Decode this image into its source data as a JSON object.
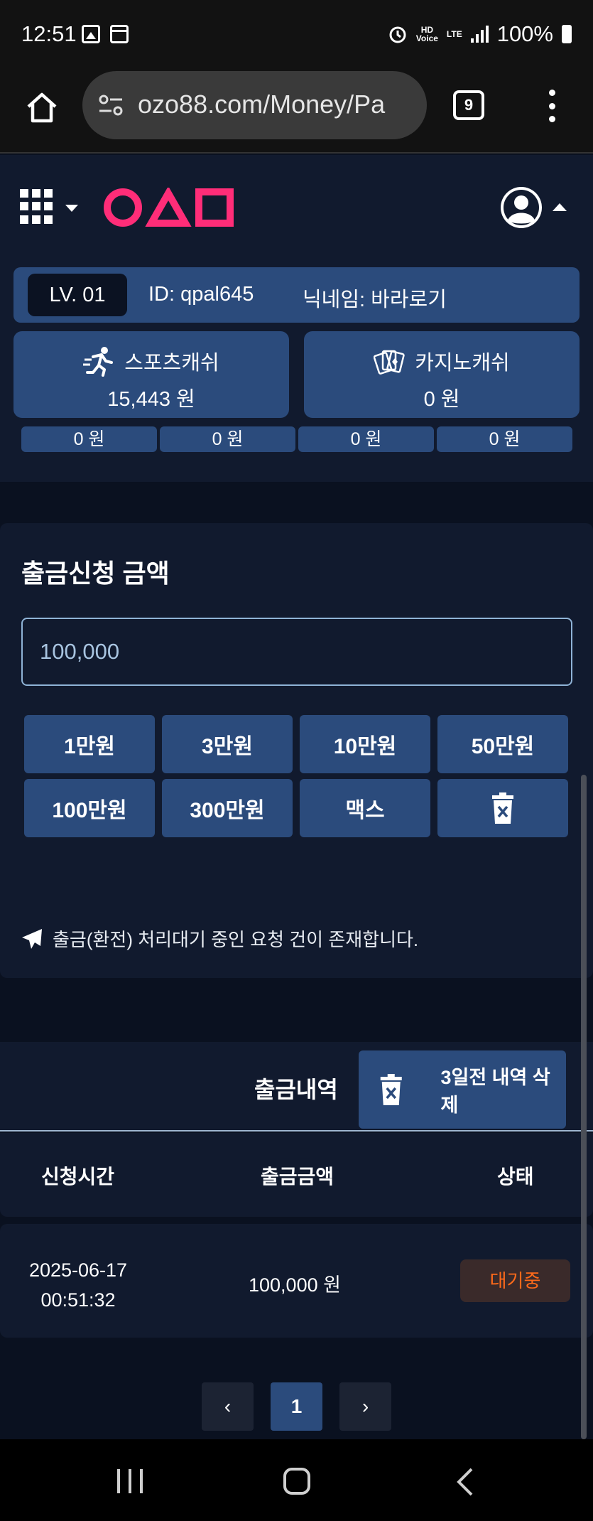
{
  "status_bar": {
    "time": "12:51",
    "hd_label": "HD",
    "voice_label": "Voice",
    "lte_label": "LTE",
    "battery": "100%"
  },
  "browser": {
    "url": "ozo88.com/Money/Pa",
    "tab_count": "9"
  },
  "header": {
    "level": "LV. 01",
    "user_id": "ID: qpal645",
    "nickname": "닉네임: 바라로기",
    "sports_cash": {
      "label": "스포츠캐쉬",
      "value": "15,443 원"
    },
    "casino_cash": {
      "label": "카지노캐쉬",
      "value": "0 원"
    },
    "mini_values": [
      "0 원",
      "0 원",
      "0 원",
      "0 원"
    ]
  },
  "withdraw": {
    "title": "출금신청 금액",
    "amount_value": "100,000",
    "buttons": [
      "1만원",
      "3만원",
      "10만원",
      "50만원",
      "100만원",
      "300만원",
      "맥스"
    ],
    "notice": "출금(환전) 처리대기 중인 요청 건이 존재합니다."
  },
  "history": {
    "title": "출금내역",
    "delete_label": "3일전 내역 삭제",
    "columns": [
      "신청시간",
      "출금금액",
      "상태"
    ],
    "rows": [
      {
        "date": "2025-06-17",
        "time": "00:51:32",
        "amount": "100,000 원",
        "status": "대기중"
      }
    ]
  },
  "pagination": {
    "prev": "‹",
    "current": "1",
    "next": "›"
  },
  "colors": {
    "panel": "#111a2e",
    "accent": "#2b4b7c",
    "logo_pink": "#ff2d78",
    "pending_orange": "#ff6a1a"
  }
}
